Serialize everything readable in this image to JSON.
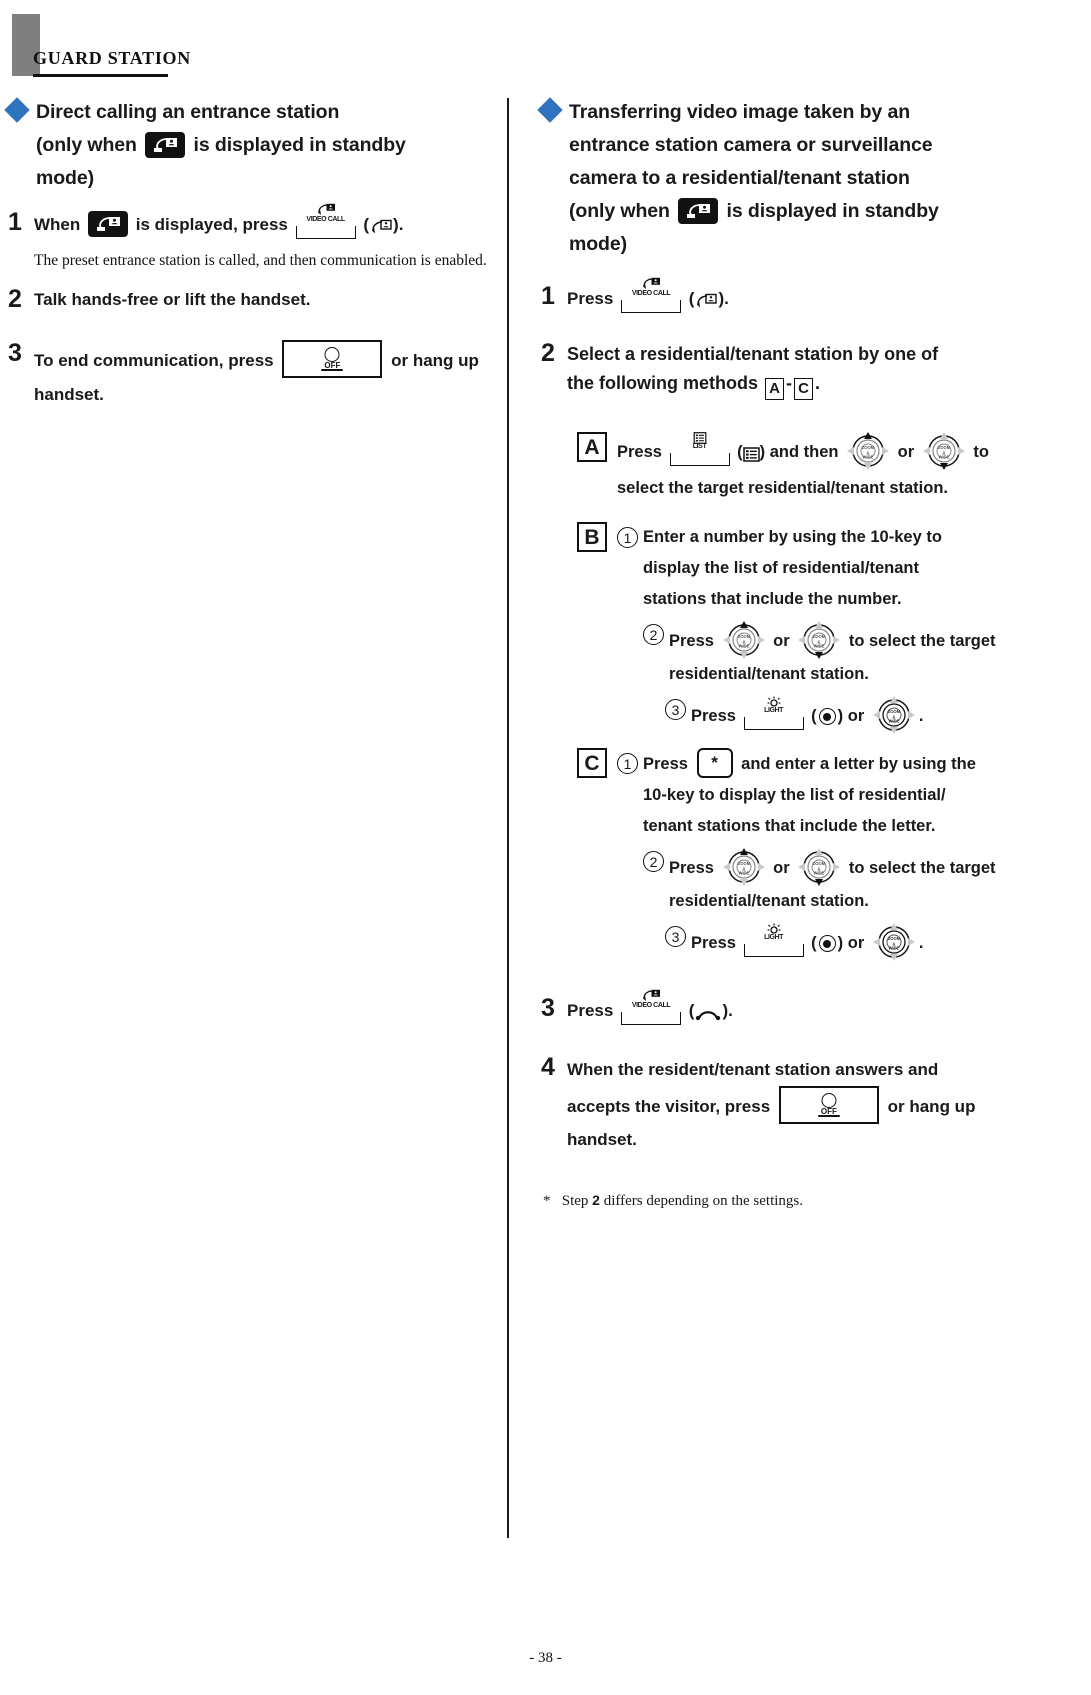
{
  "page": {
    "running_head": "GUARD STATION",
    "page_number": "- 38 -"
  },
  "colors": {
    "diamond_blue": "#2f72bd",
    "header_bar_gray": "#7f7f7f",
    "text_black": "#1a1a1a"
  },
  "left_column": {
    "heading": {
      "line1": "Direct calling an entrance station",
      "line2_prefix": "(only when",
      "line2_suffix": "is displayed in standby",
      "line3": "mode)"
    },
    "steps": [
      {
        "num": "1",
        "text_prefix": "When",
        "text_mid": "is displayed, press",
        "text_suffix": ").",
        "key_label": "VIDEO CALL",
        "paren_open": "(",
        "note": "The preset entrance station is called, and then communication is enabled."
      },
      {
        "num": "2",
        "text": "Talk hands-free or lift the handset."
      },
      {
        "num": "3",
        "text_prefix": "To end communication, press",
        "text_suffix": "or hang up handset.",
        "key_label": "OFF"
      }
    ]
  },
  "right_column": {
    "heading": {
      "line1": "Transferring video image taken by an",
      "line2": "entrance station camera or surveillance",
      "line3": "camera to a residential/tenant station",
      "line4_prefix": "(only when",
      "line4_suffix": "is displayed in standby",
      "line5": "mode)"
    },
    "step1": {
      "num": "1",
      "text_prefix": "Press",
      "paren_open": "(",
      "text_suffix": ").",
      "key_label": "VIDEO CALL"
    },
    "step2": {
      "num": "2",
      "text_line1": "Select a residential/tenant station by one of",
      "text_line2_prefix": "the following methods",
      "letter_from": "A",
      "dash": "-",
      "letter_to": "C",
      "period": "."
    },
    "methods": [
      {
        "letter": "A",
        "line1_prefix": "Press",
        "key_label": "LIST",
        "paren_open": "(",
        "line1_mid": ") and then",
        "line1_or": "or",
        "line1_suffix": "to",
        "line2": "select the target residential/tenant station."
      },
      {
        "letter": "B",
        "subs": [
          {
            "num": "1",
            "line1": "Enter a number by using the 10-key to",
            "line2": "display the list of residential/tenant",
            "line3": "stations that include the number."
          },
          {
            "num": "2",
            "line1_prefix": "Press",
            "line1_or": "or",
            "line1_suffix": "to select the target",
            "line2": "residential/tenant station."
          },
          {
            "num": "3",
            "line1_prefix": "Press",
            "key_label": "LIGHT",
            "paren_open": "(",
            "paren_close": ")",
            "line1_or": "or",
            "line1_suffix": "."
          }
        ]
      },
      {
        "letter": "C",
        "subs": [
          {
            "num": "1",
            "line1_prefix": "Press",
            "key_label": "*",
            "line1_suffix": "and enter a letter by using the",
            "line2": "10-key to display the list of residential/",
            "line3": "tenant stations that include the letter."
          },
          {
            "num": "2",
            "line1_prefix": "Press",
            "line1_or": "or",
            "line1_suffix": "to select the target",
            "line2": "residential/tenant station."
          },
          {
            "num": "3",
            "line1_prefix": "Press",
            "key_label": "LIGHT",
            "paren_open": "(",
            "paren_close": ")",
            "line1_or": "or",
            "line1_suffix": "."
          }
        ]
      }
    ],
    "step3": {
      "num": "3",
      "text_prefix": "Press",
      "paren_open": "(",
      "text_suffix": ").",
      "key_label": "VIDEO CALL"
    },
    "step4": {
      "num": "4",
      "line1": "When the resident/tenant station answers and",
      "line2_prefix": "accepts the visitor, press",
      "line2_suffix": "or hang up",
      "line3": "handset.",
      "key_label": "OFF"
    },
    "footnote": {
      "marker": "*",
      "prefix": "Step",
      "bold": "2",
      "suffix": "differs depending on the settings."
    }
  }
}
